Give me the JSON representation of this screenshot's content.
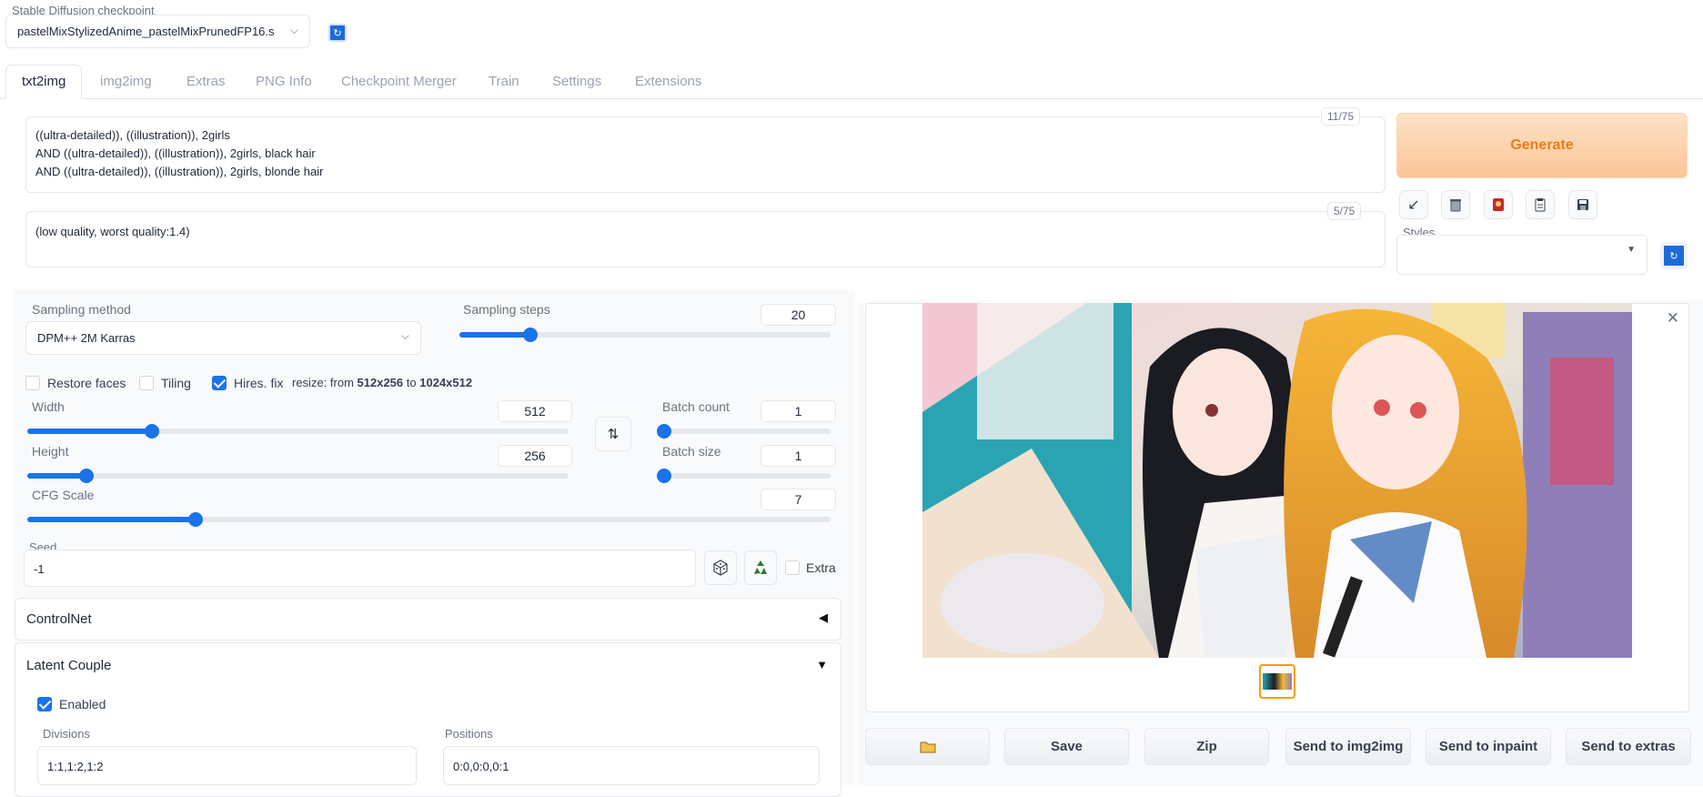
{
  "checkpoint": {
    "label": "Stable Diffusion checkpoint",
    "value": "pastelMixStylizedAnime_pastelMixPrunedFP16.s"
  },
  "tabs": [
    {
      "label": "txt2img",
      "active": true
    },
    {
      "label": "img2img"
    },
    {
      "label": "Extras"
    },
    {
      "label": "PNG Info"
    },
    {
      "label": "Checkpoint Merger"
    },
    {
      "label": "Train"
    },
    {
      "label": "Settings"
    },
    {
      "label": "Extensions"
    }
  ],
  "prompt": {
    "lines": [
      "((ultra-detailed)), ((illustration)), 2girls",
      "AND ((ultra-detailed)), ((illustration)), 2girls, black hair",
      "AND ((ultra-detailed)), ((illustration)), 2girls, blonde hair"
    ],
    "counter": "11/75"
  },
  "negative_prompt": {
    "text": "(low quality, worst quality:1.4)",
    "counter": "5/75"
  },
  "generate_label": "Generate",
  "tool_icons": [
    "arrow-icon",
    "trash-icon",
    "card-icon",
    "clipboard-icon",
    "save-icon"
  ],
  "styles_label": "Styles",
  "sampling": {
    "method_label": "Sampling method",
    "method_value": "DPM++ 2M Karras",
    "steps_label": "Sampling steps",
    "steps_value": "20",
    "steps_fraction": 0.19
  },
  "options": {
    "restore_faces": "Restore faces",
    "tiling": "Tiling",
    "hires_fix": "Hires. fix",
    "resize_prefix": "resize: from",
    "resize_from": "512x256",
    "resize_to_word": "to",
    "resize_to": "1024x512"
  },
  "width": {
    "label": "Width",
    "value": "512",
    "fraction": 0.23
  },
  "height": {
    "label": "Height",
    "value": "256",
    "fraction": 0.11
  },
  "batch_count": {
    "label": "Batch count",
    "value": "1",
    "fraction": 0.0
  },
  "batch_size": {
    "label": "Batch size",
    "value": "1",
    "fraction": 0.0
  },
  "cfg": {
    "label": "CFG Scale",
    "value": "7",
    "fraction": 0.21
  },
  "seed": {
    "label": "Seed",
    "value": "-1",
    "extra_label": "Extra"
  },
  "accordions": {
    "controlnet": "ControlNet",
    "latent_couple": "Latent Couple"
  },
  "latent": {
    "enabled_label": "Enabled",
    "divisions_label": "Divisions",
    "divisions_value": "1:1,1:2,1:2",
    "positions_label": "Positions",
    "positions_value": "0:0,0:0,0:1"
  },
  "output_buttons": {
    "folder": "folder-icon",
    "save": "Save",
    "zip": "Zip",
    "send_img2img": "Send to img2img",
    "send_inpaint": "Send to inpaint",
    "send_extras": "Send to extras"
  },
  "colors": {
    "accent": "#1a73e8",
    "generate_bg": "#fdd0a8",
    "generate_text": "#ea7b1a"
  }
}
